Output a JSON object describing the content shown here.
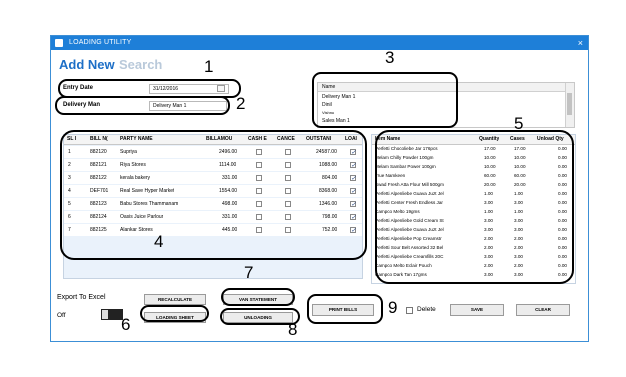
{
  "window": {
    "title": "LOADING UTILITY",
    "close_glyph": "×"
  },
  "tabs": {
    "add_new": "Add New",
    "search": "Search"
  },
  "entry_date": {
    "label": "Entry Date",
    "value": "31/12/2016"
  },
  "delivery_man": {
    "label": "Delivery Man",
    "value": "Delivery Man 1"
  },
  "name_list": {
    "header": "Name",
    "items": [
      "Delivery Man 1",
      "Dinil",
      "Vishnu",
      "Sales Man 1"
    ]
  },
  "bills_table": {
    "columns": [
      "SL I",
      "BILL N(",
      "PARTY NAME",
      "BILLAMOU",
      "CASH E",
      "CANCE",
      "OUTSTANI",
      "LOAI"
    ],
    "rows": [
      {
        "sl": "1",
        "bill": "882120",
        "party": "Supriya",
        "amount": "2496.00",
        "outstanding": "24587.00"
      },
      {
        "sl": "2",
        "bill": "882121",
        "party": "Riya Stores",
        "amount": "1114.00",
        "outstanding": "1088.00"
      },
      {
        "sl": "3",
        "bill": "882122",
        "party": "kerala bakery",
        "amount": "331.00",
        "outstanding": "804.00"
      },
      {
        "sl": "4",
        "bill": "DEF701",
        "party": "Real Save Hyper Market",
        "amount": "1554.00",
        "outstanding": "8368.00"
      },
      {
        "sl": "5",
        "bill": "882123",
        "party": "Babu Stores Thammanam",
        "amount": "498.00",
        "outstanding": "1346.00"
      },
      {
        "sl": "6",
        "bill": "882124",
        "party": "Oasis Juice Parlour",
        "amount": "331.00",
        "outstanding": "798.00"
      },
      {
        "sl": "7",
        "bill": "882125",
        "party": "Alankar Stores",
        "amount": "445.00",
        "outstanding": "752.00"
      }
    ]
  },
  "items_table": {
    "columns": [
      "Item Name",
      "Quantity",
      "Cases",
      "Unload Qty"
    ],
    "rows": [
      {
        "name": "Perfetti Chocoliebe Jar 176pcs",
        "qty": "17.00",
        "cases": "17.00",
        "unload": "0.00"
      },
      {
        "name": "Melam Chilly Powder 100gm",
        "qty": "10.00",
        "cases": "10.00",
        "unload": "0.00"
      },
      {
        "name": "Melam Sambar Power 100gm",
        "qty": "10.00",
        "cases": "10.00",
        "unload": "0.00"
      },
      {
        "name": "True Namkeen",
        "qty": "60.00",
        "cases": "60.00",
        "unload": "0.00"
      },
      {
        "name": "Swad Fresh Atta Flour Mill 500gm",
        "qty": "20.00",
        "cases": "20.00",
        "unload": "0.00"
      },
      {
        "name": "Perfetti Alpenliebe Guava Juzt Jel",
        "qty": "1.00",
        "cases": "1.00",
        "unload": "0.00"
      },
      {
        "name": "Perfetti Center Fresh Endless Jar",
        "qty": "3.00",
        "cases": "3.00",
        "unload": "0.00"
      },
      {
        "name": "Campco Melto 19gms",
        "qty": "1.00",
        "cases": "1.00",
        "unload": "0.00"
      },
      {
        "name": "Perfetti Alpenliebe Gold Cream St",
        "qty": "3.00",
        "cases": "3.00",
        "unload": "0.00"
      },
      {
        "name": "Perfetti Alpenliebe Guava Juzt Jel",
        "qty": "3.00",
        "cases": "3.00",
        "unload": "0.00"
      },
      {
        "name": "Perfetti Alpenliebe Pop Creamstr",
        "qty": "2.00",
        "cases": "2.00",
        "unload": "0.00"
      },
      {
        "name": "Perfetti Sour Belt Assorted 32 Bel",
        "qty": "2.00",
        "cases": "2.00",
        "unload": "0.00"
      },
      {
        "name": "Perfetti Alpenliebe Creamfills 20C",
        "qty": "3.00",
        "cases": "3.00",
        "unload": "0.00"
      },
      {
        "name": "Campco Melto Eclair Pouch",
        "qty": "2.00",
        "cases": "2.00",
        "unload": "0.00"
      },
      {
        "name": "Campco Dark Tan 17gms",
        "qty": "3.00",
        "cases": "3.00",
        "unload": "0.00"
      }
    ]
  },
  "buttons": {
    "recalculate": "RECALCULATE",
    "loading_sheet": "LOADING SHEET",
    "van_statement": "VAN STATEMENT",
    "unloading": "UNLOADING",
    "print_bills": "PRINT BILLS",
    "save": "SAVE",
    "clear": "CLEAR"
  },
  "export": {
    "label": "Export To Excel",
    "state": "Off"
  },
  "delete_label": "Delete",
  "annotations": [
    "1",
    "2",
    "3",
    "4",
    "5",
    "6",
    "7",
    "8",
    "9"
  ],
  "colors": {
    "titlebar": "#1e7fd8",
    "tab_active": "#1d6fc7",
    "tab_inactive": "#b9c9da"
  }
}
